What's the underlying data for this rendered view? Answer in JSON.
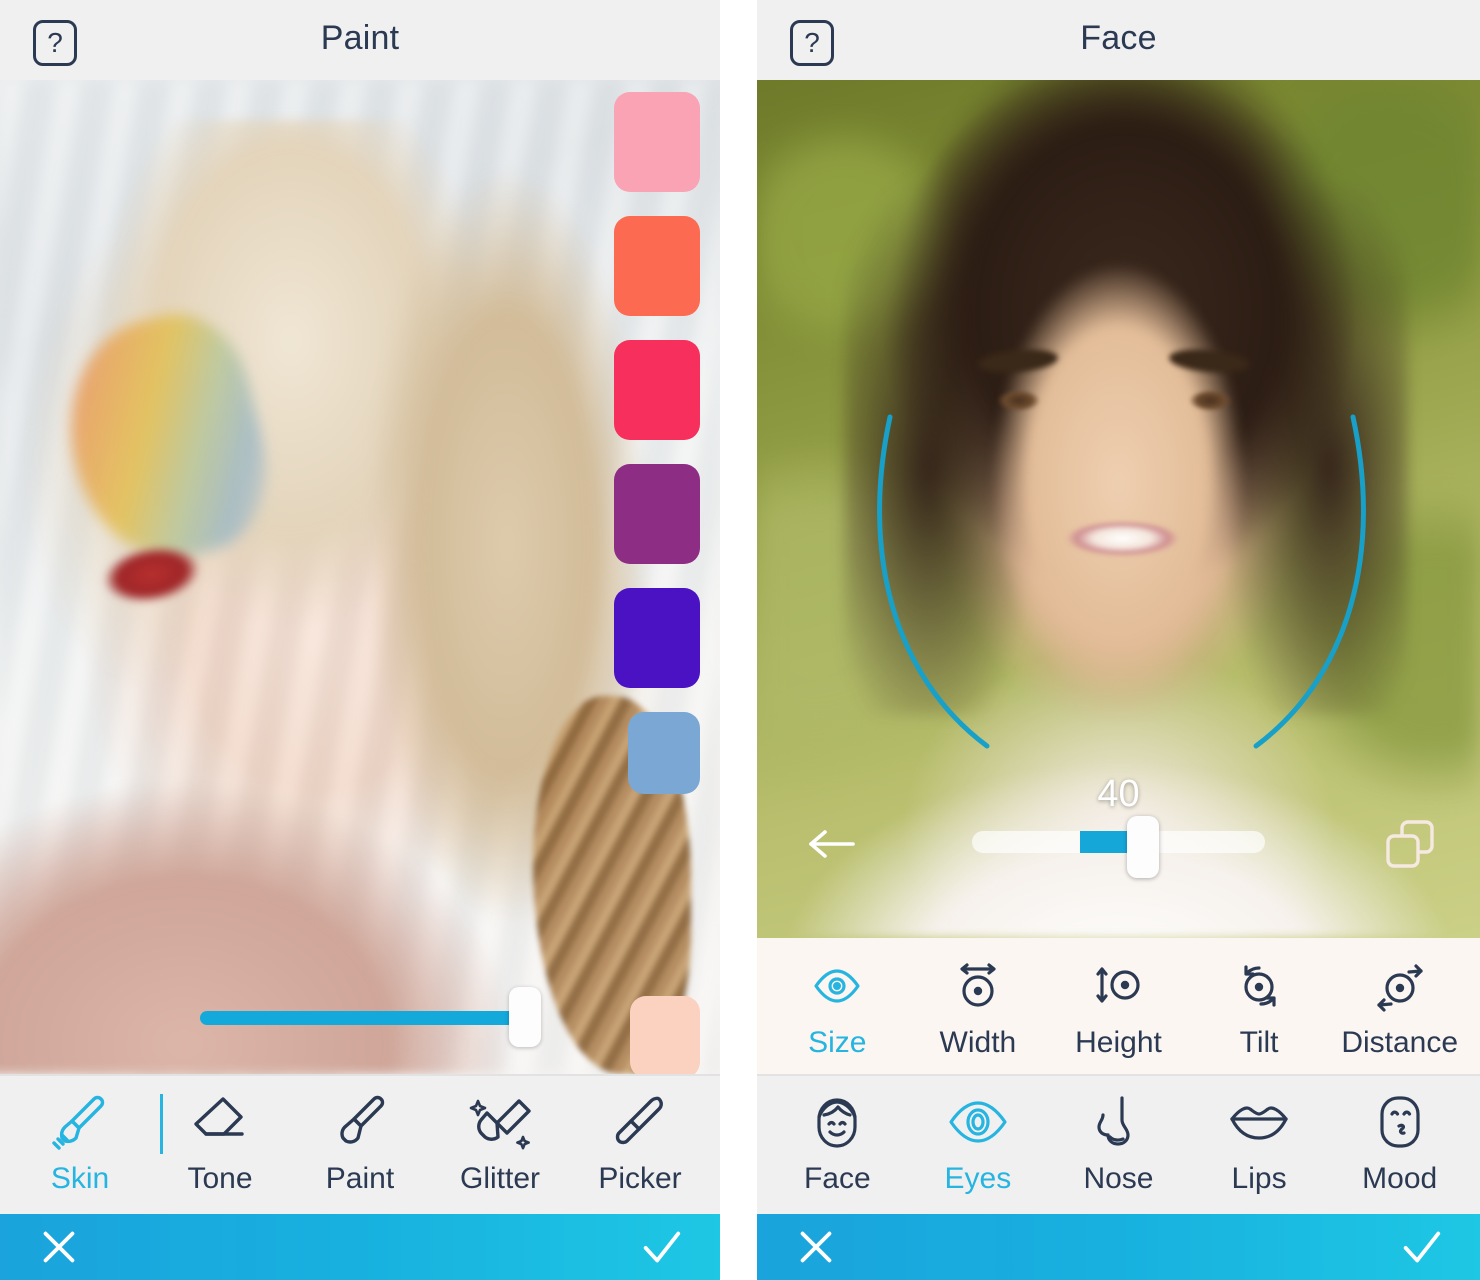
{
  "panels": [
    {
      "id": "paint",
      "header": {
        "help_label": "?",
        "title": "Paint"
      },
      "swatches": [
        {
          "name": "pink",
          "color": "#f9a3b4"
        },
        {
          "name": "coral",
          "color": "#fd6a52"
        },
        {
          "name": "crimson",
          "color": "#f62f5c"
        },
        {
          "name": "purple",
          "color": "#8d2e84"
        },
        {
          "name": "violet",
          "color": "#4b12c4"
        },
        {
          "name": "steel-blue",
          "color": "#7aa7d4"
        },
        {
          "name": "peach",
          "color": "#fbd1c0"
        }
      ],
      "slider": {
        "name": "brush-size-slider",
        "fill_percent": 100,
        "knob_percent": 100
      },
      "tools": [
        {
          "name": "skin",
          "label": "Skin",
          "icon": "brush-icon",
          "active": true
        },
        {
          "name": "tone",
          "label": "Tone",
          "icon": "eraser-icon",
          "active": false
        },
        {
          "name": "paint",
          "label": "Paint",
          "icon": "paintbrush-icon",
          "active": false
        },
        {
          "name": "glitter",
          "label": "Glitter",
          "icon": "marker-icon",
          "active": false
        },
        {
          "name": "picker",
          "label": "Picker",
          "icon": "eyedropper-icon",
          "active": false
        }
      ],
      "actions": {
        "cancel": "close-icon",
        "confirm": "check-icon"
      }
    },
    {
      "id": "face",
      "header": {
        "help_label": "?",
        "title": "Face"
      },
      "slider": {
        "name": "eye-size-slider",
        "value": "40",
        "fill_percent": 54,
        "knob_percent": 53
      },
      "back_icon": "back-arrow-icon",
      "compare_icon": "compare-icon",
      "adjust_tools": [
        {
          "name": "size",
          "label": "Size",
          "icon": "eye-size-icon",
          "active": true
        },
        {
          "name": "width",
          "label": "Width",
          "icon": "eye-width-icon",
          "active": false
        },
        {
          "name": "height",
          "label": "Height",
          "icon": "eye-height-icon",
          "active": false
        },
        {
          "name": "tilt",
          "label": "Tilt",
          "icon": "eye-tilt-icon",
          "active": false
        },
        {
          "name": "distance",
          "label": "Distance",
          "icon": "eye-distance-icon",
          "active": false
        }
      ],
      "feature_tools": [
        {
          "name": "face",
          "label": "Face",
          "icon": "face-icon",
          "active": false
        },
        {
          "name": "eyes",
          "label": "Eyes",
          "icon": "eye-icon",
          "active": true
        },
        {
          "name": "nose",
          "label": "Nose",
          "icon": "nose-icon",
          "active": false
        },
        {
          "name": "lips",
          "label": "Lips",
          "icon": "lips-icon",
          "active": false
        },
        {
          "name": "mood",
          "label": "Mood",
          "icon": "mood-icon",
          "active": false
        }
      ],
      "actions": {
        "cancel": "close-icon",
        "confirm": "check-icon"
      }
    }
  ],
  "theme": {
    "accent": "#26b4e0",
    "accent_dark": "#14a9db",
    "ink": "#2b3a52",
    "chrome_bg": "#f0f0f0",
    "guide_color": "#18a0c8"
  }
}
